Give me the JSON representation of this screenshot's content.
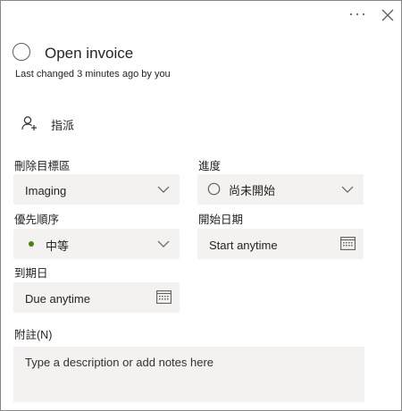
{
  "header": {
    "more_icon": "more-horizontal-icon",
    "close_icon": "close-icon",
    "more_glyph": "···"
  },
  "task": {
    "title": "Open invoice",
    "subtitle": "Last changed 3 minutes ago by you"
  },
  "assign": {
    "label": "指派",
    "icon": "add-person-icon"
  },
  "bucket": {
    "label": "刪除目標區",
    "value": "Imaging"
  },
  "progress": {
    "label": "進度",
    "value": "尚未開始"
  },
  "priority": {
    "label": "優先順序",
    "value": "中等",
    "dot_color": "#498205"
  },
  "start_date": {
    "label": "開始日期",
    "value": "Start anytime"
  },
  "due_date": {
    "label": "到期日",
    "value": "Due anytime"
  },
  "notes": {
    "label": "附註(N)",
    "placeholder": "Type a description or add notes here"
  }
}
